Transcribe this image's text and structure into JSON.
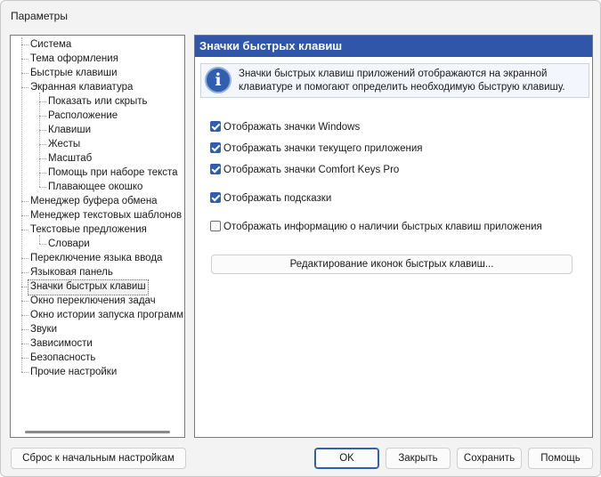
{
  "window": {
    "title": "Параметры"
  },
  "tree": {
    "items": [
      {
        "label": "Система",
        "level": 0
      },
      {
        "label": "Тема оформления",
        "level": 0
      },
      {
        "label": "Быстрые клавиши",
        "level": 0
      },
      {
        "label": "Экранная клавиатура",
        "level": 0
      },
      {
        "label": "Показать или скрыть",
        "level": 1
      },
      {
        "label": "Расположение",
        "level": 1
      },
      {
        "label": "Клавиши",
        "level": 1
      },
      {
        "label": "Жесты",
        "level": 1
      },
      {
        "label": "Масштаб",
        "level": 1
      },
      {
        "label": "Помощь при наборе текста",
        "level": 1
      },
      {
        "label": "Плавающее окошко",
        "level": 1
      },
      {
        "label": "Менеджер буфера обмена",
        "level": 0
      },
      {
        "label": "Менеджер текстовых шаблонов",
        "level": 0
      },
      {
        "label": "Текстовые предложения",
        "level": 0
      },
      {
        "label": "Словари",
        "level": 1
      },
      {
        "label": "Переключение языка ввода",
        "level": 0
      },
      {
        "label": "Языковая панель",
        "level": 0
      },
      {
        "label": "Значки быстрых клавиш",
        "level": 0,
        "selected": true
      },
      {
        "label": "Окно переключения задач",
        "level": 0
      },
      {
        "label": "Окно истории запуска программ",
        "level": 0
      },
      {
        "label": "Звуки",
        "level": 0
      },
      {
        "label": "Зависимости",
        "level": 0
      },
      {
        "label": "Безопасность",
        "level": 0
      },
      {
        "label": "Прочие настройки",
        "level": 0
      }
    ]
  },
  "panel": {
    "header": "Значки быстрых клавиш",
    "info_icon": "info-icon",
    "info_text": "Значки быстрых клавиш приложений отображаются на экранной клавиатуре и помогают определить необходимую быструю клавишу.",
    "checkboxes": [
      {
        "label": "Отображать значки Windows",
        "checked": true
      },
      {
        "label": "Отображать значки текущего приложения",
        "checked": true
      },
      {
        "label": "Отображать значки Comfort Keys Pro",
        "checked": true
      },
      {
        "label": "Отображать подсказки",
        "checked": true
      },
      {
        "label": "Отображать информацию о наличии быстрых клавиш приложения",
        "checked": false
      }
    ],
    "edit_button": "Редактирование иконок быстрых клавиш..."
  },
  "footer": {
    "reset": "Сброс к начальным настройкам",
    "ok": "OK",
    "close": "Закрыть",
    "save": "Сохранить",
    "help": "Помощь"
  },
  "colors": {
    "accent": "#2f56a8",
    "checkbox": "#2f5fae"
  }
}
